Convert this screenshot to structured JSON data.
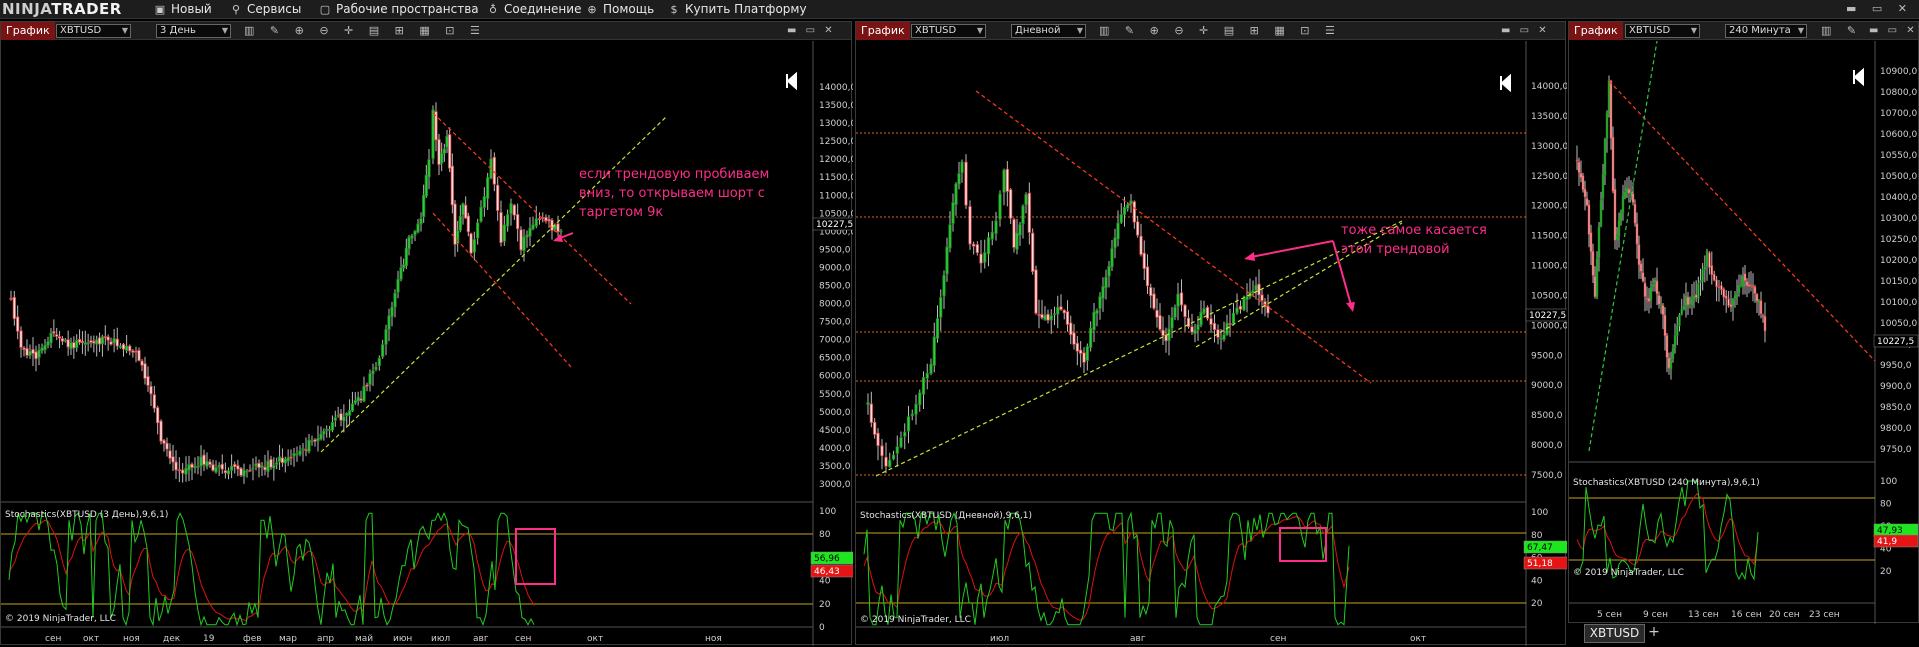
{
  "app": {
    "logo_part1": "NINJA",
    "logo_part2": "TRADER",
    "menu": [
      {
        "label": "Новый",
        "icon": "new-window-icon"
      },
      {
        "label": "Сервисы",
        "icon": "tools-icon"
      },
      {
        "label": "Рабочие пространства",
        "icon": "workspaces-icon"
      },
      {
        "label": "Соединение",
        "icon": "connection-icon"
      },
      {
        "label": "Помощь",
        "icon": "help-icon"
      },
      {
        "label": "Купить Платформу",
        "icon": "dollar-icon"
      }
    ],
    "bottom_tab": "XBTUSD",
    "add_tab": "+",
    "colors": {
      "up_candle": "#2ecc40",
      "down_candle": "#e8e8e8",
      "trend_red": "#ff3b1f",
      "trend_yellow": "#c8e632",
      "stoch_k": "#22cc22",
      "stoch_d": "#dd1111",
      "annotation": "#ff2d8a",
      "level": "#c6a316"
    }
  },
  "panels": [
    {
      "id": "left",
      "tag": "График",
      "instrument": "XBTUSD",
      "interval": "3 День",
      "stoch_label": "Stochastics(XBTUSD (3 День),9,6,1)",
      "copyright": "© 2019 NinjaTrader, LLC",
      "last_price": "10227,5",
      "k_value": "56,96",
      "d_value": "46,43",
      "annotation": [
        "если трендовую пробиваем",
        "вниз, то открываем шорт с",
        "таргетом 9к"
      ],
      "price_ticks": [
        "14000,0",
        "13500,0",
        "13000,0",
        "12500,0",
        "12000,0",
        "11500,0",
        "11000,0",
        "10500,0",
        "10000,0",
        "9500,0",
        "9000,0",
        "8500,0",
        "8000,0",
        "7500,0",
        "7000,0",
        "6500,0",
        "6000,0",
        "5500,0",
        "5000,0",
        "4500,0",
        "4000,0",
        "3500,0",
        "3000,0"
      ],
      "stoch_ticks": [
        "100",
        "80",
        "60",
        "40",
        "20",
        "0"
      ],
      "time_ticks": [
        "сен",
        "окт",
        "ноя",
        "дек",
        "19",
        "фев",
        "мар",
        "апр",
        "май",
        "июн",
        "июл",
        "авг",
        "сен",
        "окт",
        "ноя"
      ]
    },
    {
      "id": "middle",
      "tag": "График",
      "instrument": "XBTUSD",
      "interval": "Дневной",
      "stoch_label": "Stochastics(XBTUSD (Дневной),9,6,1)",
      "copyright": "© 2019 NinjaTrader, LLC",
      "last_price": "10227,5",
      "k_value": "67,47",
      "d_value": "51,18",
      "annotation": [
        "тоже самое касается",
        "этой трендовой"
      ],
      "price_ticks": [
        "14000,0",
        "13500,0",
        "13000,0",
        "12500,0",
        "12000,0",
        "11500,0",
        "11000,0",
        "10500,0",
        "10000,0",
        "9500,0",
        "9000,0",
        "8500,0",
        "8000,0",
        "7500,0"
      ],
      "stoch_ticks": [
        "100",
        "80",
        "60",
        "40",
        "20"
      ],
      "time_ticks": [
        "июл",
        "авг",
        "сен",
        "окт"
      ]
    },
    {
      "id": "right",
      "tag": "График",
      "instrument": "XBTUSD",
      "interval": "240 Минута",
      "stoch_label": "Stochastics(XBTUSD (240 Минута),9,6,1)",
      "copyright": "© 2019 NinjaTrader, LLC",
      "last_price": "10227,5",
      "k_value": "47,93",
      "d_value": "41,9",
      "price_ticks": [
        "10900,0",
        "10800,0",
        "10700,0",
        "10600,0",
        "10550,0",
        "10500,0",
        "10400,0",
        "10300,0",
        "10250,0",
        "10200,0",
        "10150,0",
        "10100,0",
        "10050,0",
        "10000,0",
        "9950,0",
        "9900,0",
        "9850,0",
        "9800,0",
        "9750,0"
      ],
      "stoch_ticks": [
        "100",
        "80",
        "60",
        "40",
        "20"
      ],
      "time_ticks": [
        "5 сен",
        "9 сен",
        "13 сен",
        "16 сен",
        "20 сен",
        "23 сен"
      ]
    }
  ]
}
